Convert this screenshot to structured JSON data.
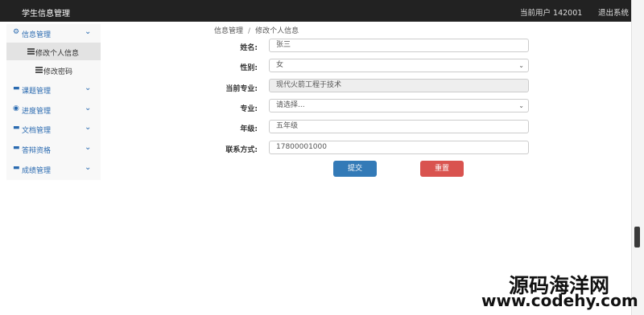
{
  "app": {
    "title": "学生信息管理"
  },
  "header": {
    "current_user": "当前用户 142001",
    "logout": "退出系统"
  },
  "sidebar": {
    "items": [
      {
        "label": "信息管理",
        "icon": "gear-icon",
        "expanded": true,
        "children": [
          {
            "label": "修改个人信息",
            "active": true
          },
          {
            "label": "修改密码",
            "active": false
          }
        ]
      },
      {
        "label": "课题管理",
        "icon": "card-icon"
      },
      {
        "label": "进度管理",
        "icon": "globe-icon"
      },
      {
        "label": "文档管理",
        "icon": "card-icon"
      },
      {
        "label": "答辩资格",
        "icon": "card-icon"
      },
      {
        "label": "成绩管理",
        "icon": "card-icon"
      }
    ]
  },
  "breadcrumb": {
    "root": "信息管理",
    "separator": "/",
    "current": "修改个人信息"
  },
  "form": {
    "name": {
      "label": "姓名:",
      "value": "张三"
    },
    "gender": {
      "label": "性别:",
      "value": "女"
    },
    "current_major": {
      "label": "当前专业:",
      "value": "现代火箭工程于技术"
    },
    "major": {
      "label": "专业:",
      "value": "请选择..."
    },
    "grade": {
      "label": "年级:",
      "value": "五年级"
    },
    "contact": {
      "label": "联系方式:",
      "value": "17800001000"
    },
    "submit": "提交",
    "reset": "重置"
  },
  "watermark": {
    "cn": "源码海洋网",
    "url": "www.codehy.com"
  },
  "colors": {
    "topbar": "#222222",
    "primary": "#337ab7",
    "danger": "#d9534f",
    "sidebar_link": "#2a6ab0"
  }
}
